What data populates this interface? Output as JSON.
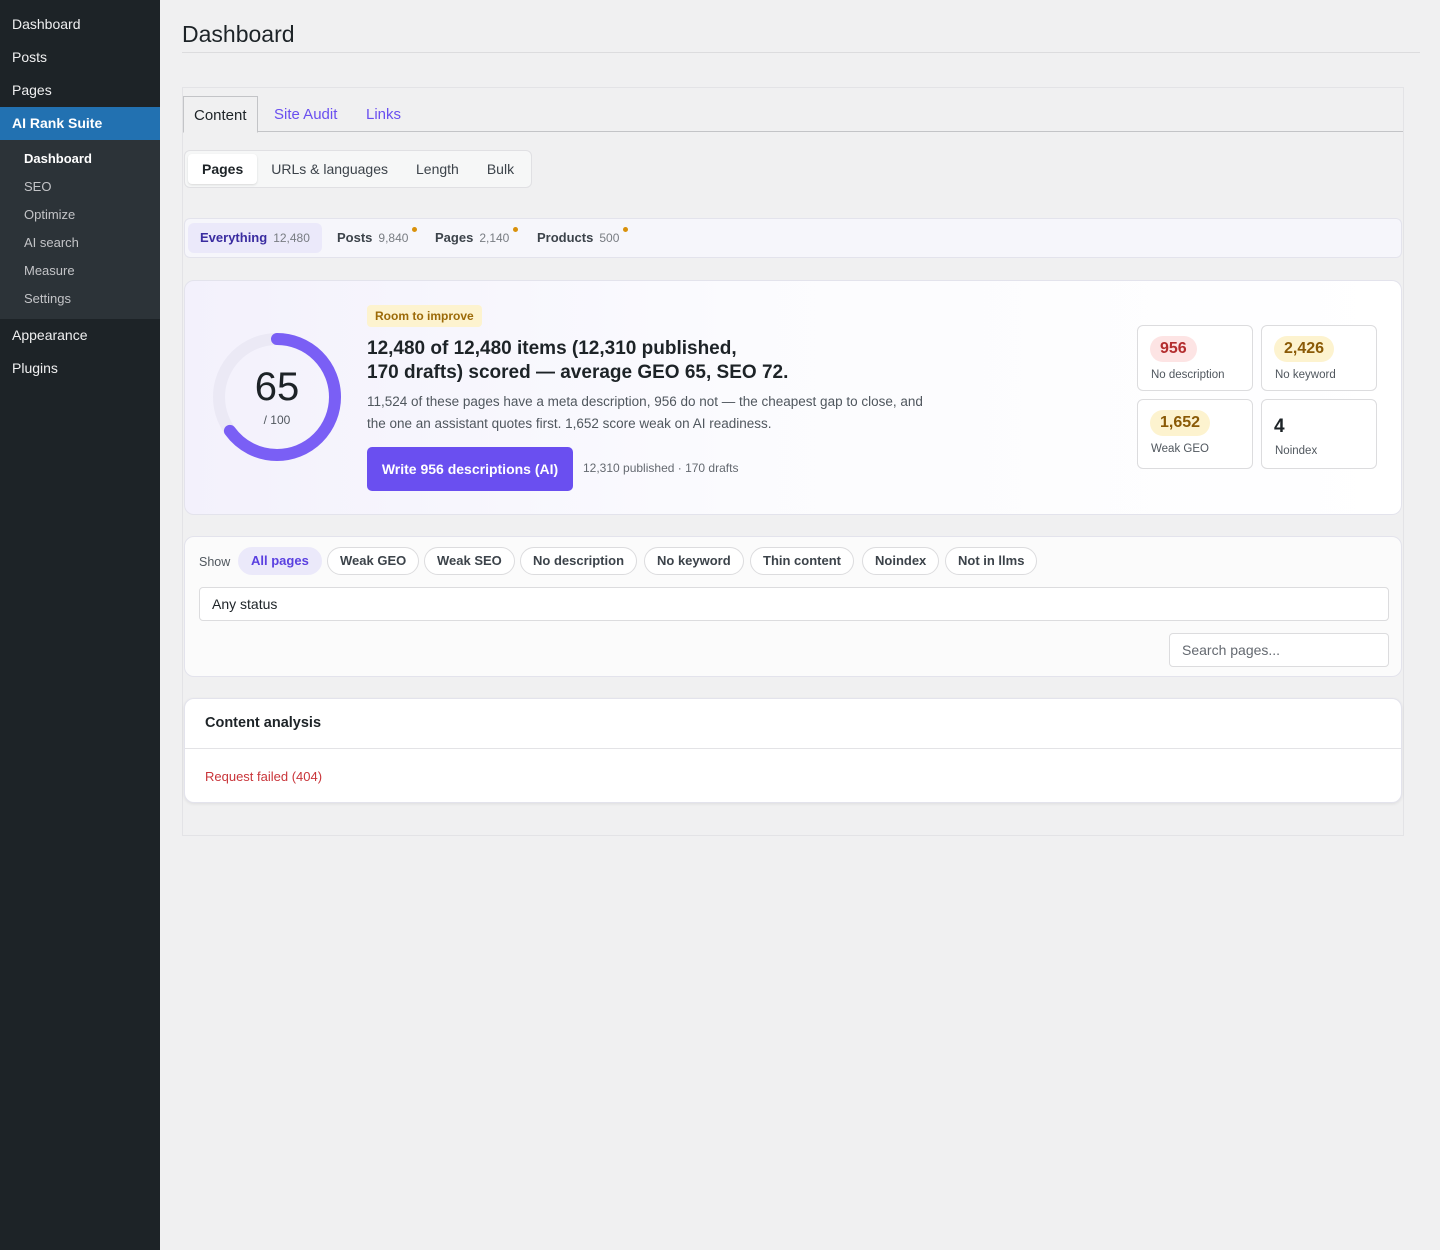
{
  "sidebar": {
    "items_top": [
      {
        "label": "Dashboard"
      },
      {
        "label": "Posts"
      },
      {
        "label": "Pages"
      }
    ],
    "current": {
      "label": "AI Rank Suite"
    },
    "submenu": [
      {
        "label": "Dashboard",
        "current": true
      },
      {
        "label": "SEO"
      },
      {
        "label": "Optimize"
      },
      {
        "label": "AI search"
      },
      {
        "label": "Measure"
      },
      {
        "label": "Settings"
      }
    ],
    "items_bottom": [
      {
        "label": "Appearance"
      },
      {
        "label": "Plugins"
      }
    ]
  },
  "page": {
    "title": "Dashboard"
  },
  "tabs": [
    {
      "label": "Content",
      "active": true
    },
    {
      "label": "Site Audit"
    },
    {
      "label": "Links"
    }
  ],
  "subtabs": [
    {
      "label": "Pages",
      "active": true
    },
    {
      "label": "URLs & languages"
    },
    {
      "label": "Length"
    },
    {
      "label": "Bulk"
    }
  ],
  "types": [
    {
      "label": "Everything",
      "count": "12,480",
      "active": true
    },
    {
      "label": "Posts",
      "count": "9,840",
      "dot": true
    },
    {
      "label": "Pages",
      "count": "2,140",
      "dot": true
    },
    {
      "label": "Products",
      "count": "500",
      "dot": true
    }
  ],
  "hero": {
    "score": "65",
    "score_max": "/ 100",
    "score_fraction": 0.65,
    "badge": "Room to improve",
    "title_line1": "12,480 of 12,480 items (12,310 published,",
    "title_line2": "170 drafts) scored — average GEO 65, SEO 72.",
    "desc_line1": "11,524 of these pages have a meta description, 956 do not — the cheapest gap to close, and",
    "desc_line2": "the one an assistant quotes first. 1,652 score weak on AI readiness.",
    "button": "Write 956 descriptions (AI)",
    "meta": "12,310 published · 170 drafts"
  },
  "stats": [
    {
      "value": "956",
      "label": "No description",
      "tone": "red"
    },
    {
      "value": "2,426",
      "label": "No keyword",
      "tone": "amber"
    },
    {
      "value": "1,652",
      "label": "Weak GEO",
      "tone": "amber"
    },
    {
      "value": "4",
      "label": "Noindex",
      "tone": "plain"
    }
  ],
  "filters": {
    "show_label": "Show",
    "chips": [
      {
        "label": "All pages",
        "active": true
      },
      {
        "label": "Weak GEO"
      },
      {
        "label": "Weak SEO"
      },
      {
        "label": "No description"
      },
      {
        "label": "No keyword"
      },
      {
        "label": "Thin content"
      },
      {
        "label": "Noindex"
      },
      {
        "label": "Not in llms"
      }
    ],
    "status_value": "Any status",
    "search_placeholder": "Search pages..."
  },
  "analysis": {
    "title": "Content analysis",
    "error": "Request failed (404)"
  },
  "colors": {
    "accent": "#6a4ff0",
    "sidebar_bg": "#1d2327",
    "sidebar_current": "#2271b1",
    "danger": "#c9353a",
    "warning": "#d9910b"
  }
}
